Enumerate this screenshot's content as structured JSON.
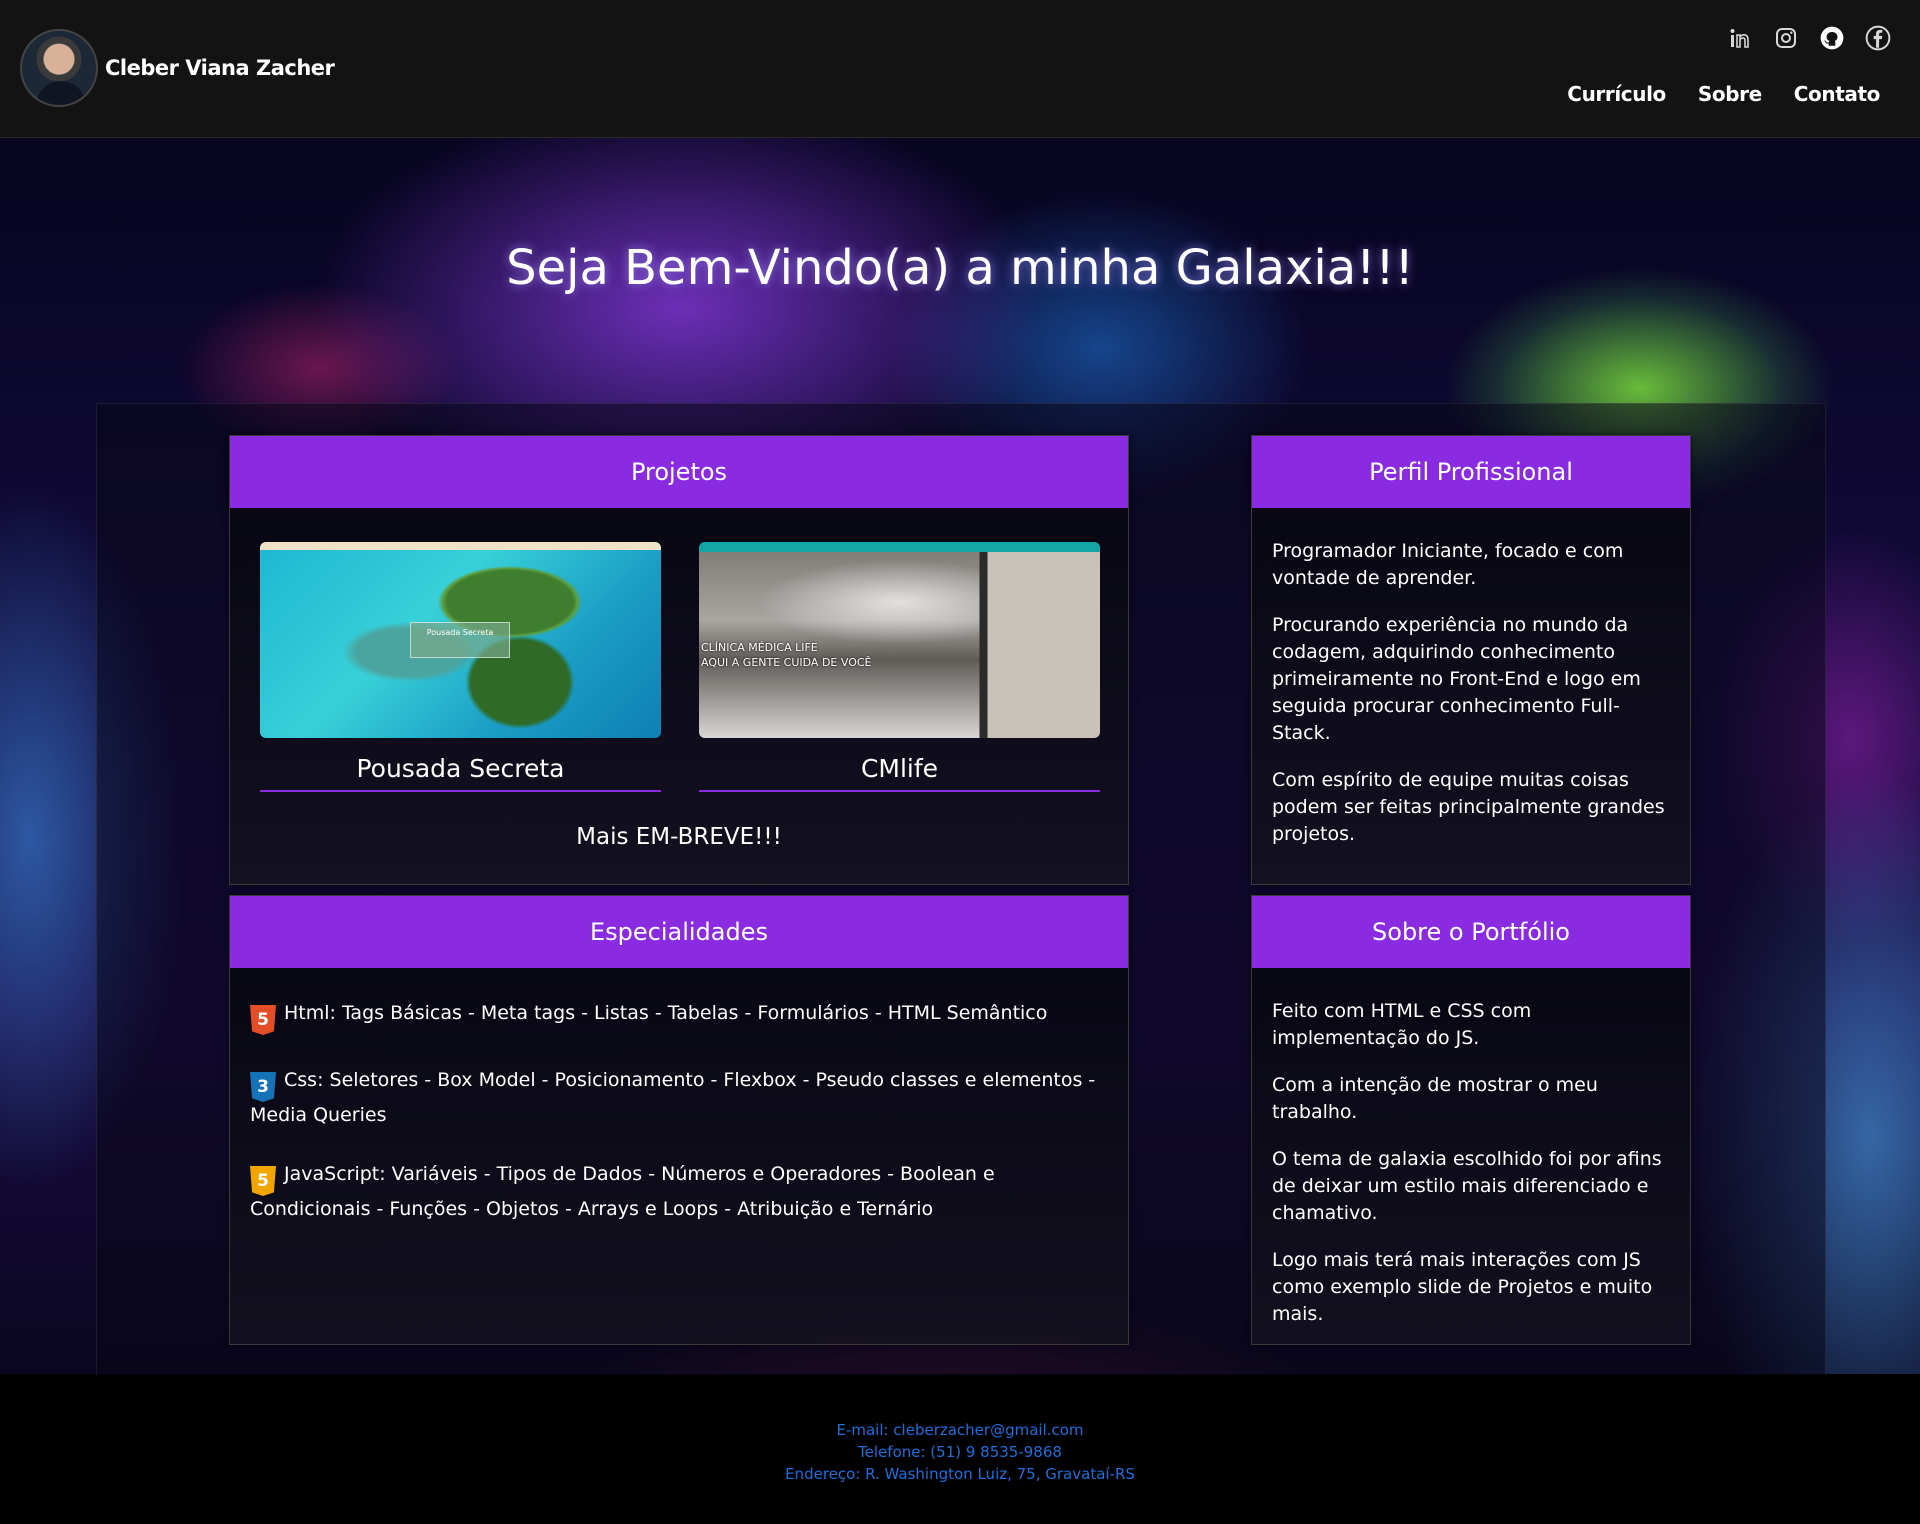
{
  "header": {
    "name": "Cleber Viana Zacher",
    "social": [
      "linkedin-icon",
      "instagram-icon",
      "github-icon",
      "facebook-icon"
    ],
    "nav": [
      "Currículo",
      "Sobre",
      "Contato"
    ]
  },
  "hero": {
    "title": "Seja Bem-Vindo(a) a minha Galaxia!!!"
  },
  "projects": {
    "heading": "Projetos",
    "items": [
      {
        "title": "Pousada Secreta",
        "thumb_caption": "Pousada Secreta"
      },
      {
        "title": "CMlife",
        "thumb_caption_1": "CLÍNICA MÉDICA LIFE",
        "thumb_caption_2": "AQUI A GENTE CUIDA DE VOCÊ"
      }
    ],
    "more": "Mais EM-BREVE!!!"
  },
  "perfil": {
    "heading": "Perfil Profissional",
    "paragraphs": [
      "Programador Iniciante, focado e com vontade de aprender.",
      "Procurando experiência no mundo da codagem, adquirindo conhecimento primeiramente no Front-End e logo em seguida procurar conhecimento Full-Stack.",
      "Com espírito de equipe muitas coisas podem ser feitas principalmente grandes projetos."
    ]
  },
  "especialidades": {
    "heading": "Especialidades",
    "items": [
      {
        "badge": "5",
        "text": "Html: Tags Básicas - Meta tags - Listas - Tabelas - Formulários - HTML Semântico"
      },
      {
        "badge": "3",
        "text": "Css: Seletores - Box Model - Posicionamento - Flexbox - Pseudo classes e elementos - Media Queries"
      },
      {
        "badge": "5",
        "text": "JavaScript: Variáveis - Tipos de Dados - Números e Operadores - Boolean e Condicionais - Funções - Objetos - Arrays e Loops - Atribuição e Ternário"
      }
    ]
  },
  "sobre": {
    "heading": "Sobre o Portfólio",
    "paragraphs": [
      "Feito com HTML e CSS com implementação do JS.",
      "Com a intenção de mostrar o meu trabalho.",
      "O tema de galaxia escolhido foi por afins de deixar um estilo mais diferenciado e chamativo.",
      "Logo mais terá mais interações com JS como exemplo slide de Projetos e muito mais."
    ]
  },
  "footer": {
    "email": "E-mail: cleberzacher@gmail.com",
    "phone": "Telefone: (51) 9 8535-9868",
    "address": "Endereço: R. Washington Luiz, 75, Gravataí-RS"
  },
  "colors": {
    "accent": "#8a2be2",
    "footer_text": "#1e6ee0"
  }
}
